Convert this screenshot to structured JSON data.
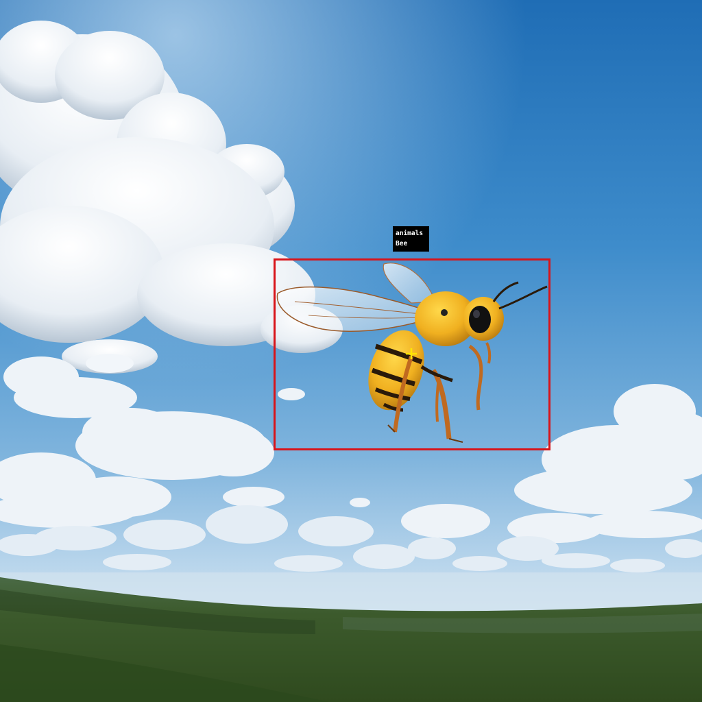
{
  "scene": {
    "subject": "bee",
    "sky_color_top": "#1d6fb8",
    "sky_color_horizon": "#cfe2f0",
    "forest_color": "#3d5a2a"
  },
  "detection": {
    "category": "animals",
    "label": "Bee",
    "box_color": "#d8141a",
    "center_marker_color": "#ffe600"
  }
}
